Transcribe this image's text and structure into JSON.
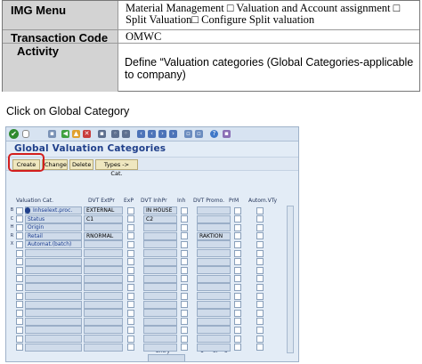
{
  "info_table": {
    "rows": [
      {
        "label": "IMG Menu",
        "value": "Material Management □ Valuation and Account assignment □ Split Valuation□ Configure Split valuation"
      },
      {
        "label": "Transaction Code",
        "value": "OMWC"
      },
      {
        "label": "Activity",
        "value": "Define “Valuation categories (Global Categories-applicable to company)"
      }
    ]
  },
  "caption": "Click on Global Category",
  "sap": {
    "title": "Global Valuation Categories",
    "buttons": [
      "Create",
      "Change",
      "Delete",
      "Types -> Cat."
    ],
    "columns": [
      "Valuation Cat.",
      "DVT ExtPr",
      "ExP",
      "DVT InhPr",
      "Inh",
      "DVT Promo.",
      "PrM",
      "Autom.VTy"
    ],
    "rows": [
      {
        "key": "B",
        "cat": "Inhselext.proc.",
        "ext": "EXTERNAL",
        "inh": "IN HOUSE",
        "promo": ""
      },
      {
        "key": "C",
        "cat": "Status",
        "ext": "C1",
        "inh": "C2",
        "promo": ""
      },
      {
        "key": "H",
        "cat": "Origin",
        "ext": "",
        "inh": "",
        "promo": ""
      },
      {
        "key": "R",
        "cat": "Retail",
        "ext": "RNORMAL",
        "inh": "",
        "promo": "RAKTION"
      },
      {
        "key": "X",
        "cat": "Automat.(batch)",
        "ext": "",
        "inh": "",
        "promo": ""
      }
    ],
    "footer": {
      "entry_label": "Entry",
      "page": "1",
      "of_label": "of",
      "total": "5"
    },
    "toolbar_icons": [
      "enter-icon",
      "save-icon",
      "back-icon",
      "exit-icon",
      "cancel-icon",
      "print-icon",
      "find-icon",
      "find-next-icon",
      "first-page-icon",
      "prev-page-icon",
      "next-page-icon",
      "last-page-icon",
      "new-session-icon",
      "shortcut-icon",
      "help-icon",
      "customize-icon"
    ]
  }
}
